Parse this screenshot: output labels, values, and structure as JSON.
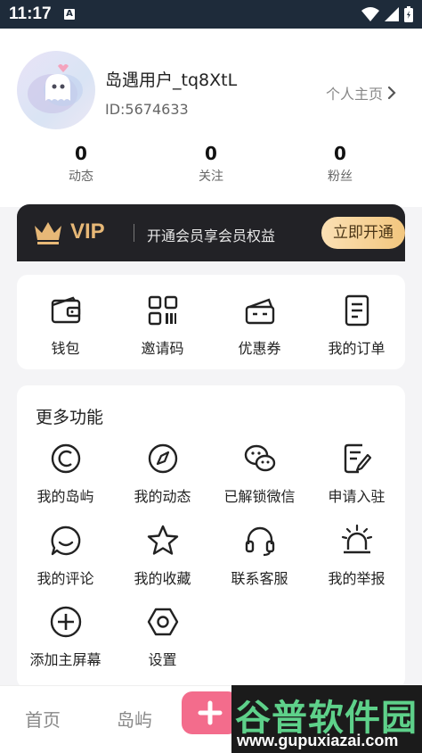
{
  "status_bar": {
    "time": "11:17",
    "indicator": "A"
  },
  "profile": {
    "username": "岛遇用户_tq8XtL",
    "user_id": "ID:5674633",
    "homepage_link": "个人主页",
    "stats": [
      {
        "value": "0",
        "label": "动态"
      },
      {
        "value": "0",
        "label": "关注"
      },
      {
        "value": "0",
        "label": "粉丝"
      }
    ]
  },
  "vip": {
    "title": "VIP",
    "description": "开通会员享会员权益",
    "button": "立即开通"
  },
  "quick_actions": [
    {
      "label": "钱包",
      "icon": "wallet-icon"
    },
    {
      "label": "邀请码",
      "icon": "qr-code-icon"
    },
    {
      "label": "优惠券",
      "icon": "coupon-icon"
    },
    {
      "label": "我的订单",
      "icon": "order-icon"
    }
  ],
  "more": {
    "title": "更多功能",
    "items": [
      {
        "label": "我的岛屿",
        "icon": "island-icon"
      },
      {
        "label": "我的动态",
        "icon": "compass-icon"
      },
      {
        "label": "已解锁微信",
        "icon": "wechat-icon"
      },
      {
        "label": "申请入驻",
        "icon": "apply-icon"
      },
      {
        "label": "我的评论",
        "icon": "comment-icon"
      },
      {
        "label": "我的收藏",
        "icon": "star-icon"
      },
      {
        "label": "联系客服",
        "icon": "headset-icon"
      },
      {
        "label": "我的举报",
        "icon": "alarm-icon"
      },
      {
        "label": "添加主屏幕",
        "icon": "add-circle-icon"
      },
      {
        "label": "设置",
        "icon": "settings-icon"
      }
    ]
  },
  "bottom_nav": {
    "home": "首页",
    "islands": "岛屿",
    "plus": "+"
  },
  "watermark": {
    "title": "谷普软件园",
    "url": "www.gupuxiazai.com"
  },
  "colors": {
    "accent": "#f36c8c",
    "vip_gold": "#e7b877",
    "watermark_green": "#5ed18a"
  }
}
